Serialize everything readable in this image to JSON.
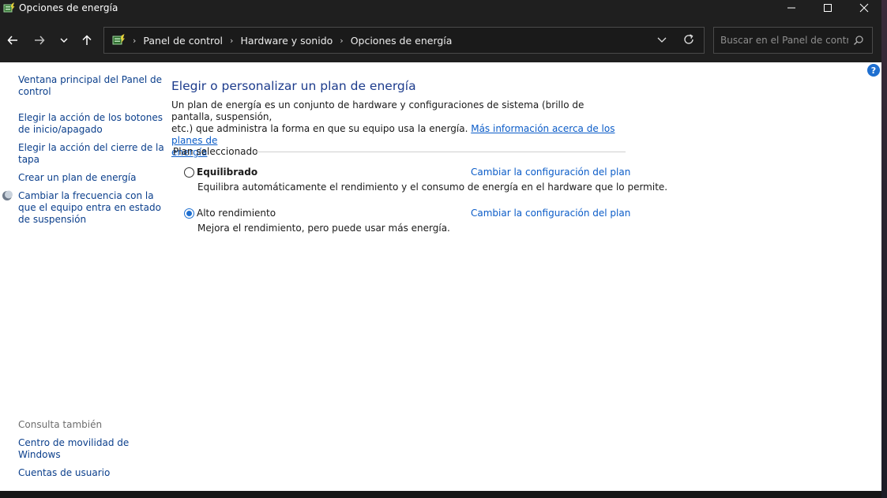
{
  "window": {
    "title": "Opciones de energía",
    "icon": "power-options-icon"
  },
  "nav": {
    "back": "arrow-left-icon",
    "forward": "arrow-right-icon",
    "recent": "chevron-down-icon",
    "up": "arrow-up-icon"
  },
  "breadcrumb": {
    "items": [
      "Panel de control",
      "Hardware y sonido",
      "Opciones de energía"
    ]
  },
  "search": {
    "placeholder": "Buscar en el Panel de control"
  },
  "leftnav": {
    "items": [
      {
        "label1": "Ventana principal del Panel de",
        "label2": "control"
      },
      {
        "label1": "Elegir la acción de los botones",
        "label2": "de inicio/apagado"
      },
      {
        "label1": "Elegir la acción del cierre de la",
        "label2": "tapa"
      },
      {
        "label1": "Crear un plan de energía"
      },
      {
        "label1": "Cambiar la frecuencia con la",
        "label2": "que el equipo entra en estado",
        "label3": "de suspensión"
      }
    ],
    "see_also": "Consulta también",
    "see_also_items": [
      {
        "label1": "Centro de movilidad de",
        "label2": "Windows"
      },
      {
        "label1": "Cuentas de usuario"
      }
    ]
  },
  "main": {
    "heading": "Elegir o personalizar un plan de energía",
    "desc_line1": "Un plan de energía es un conjunto de hardware y configuraciones de sistema (brillo de pantalla, suspensión,",
    "desc_line2_text": "etc.) que administra la forma en que su equipo usa la energía. ",
    "desc_link_1": "Más información acerca de los planes de",
    "desc_link_2": "energía",
    "group_label": "Plan seleccionado",
    "plans": [
      {
        "name": "Equilibrado",
        "desc": "Equilibra automáticamente el rendimiento y el consumo de energía en el hardware que lo permite.",
        "link": "Cambiar la configuración del plan",
        "selected": false
      },
      {
        "name": "Alto rendimiento",
        "desc": "Mejora el rendimiento, pero puede usar más energía.",
        "link": "Cambiar la configuración del plan",
        "selected": true
      }
    ]
  },
  "help": "?",
  "colors": {
    "link": "#0b5cc8",
    "heading": "#1c3b8c",
    "accent": "#1e6fd0"
  }
}
